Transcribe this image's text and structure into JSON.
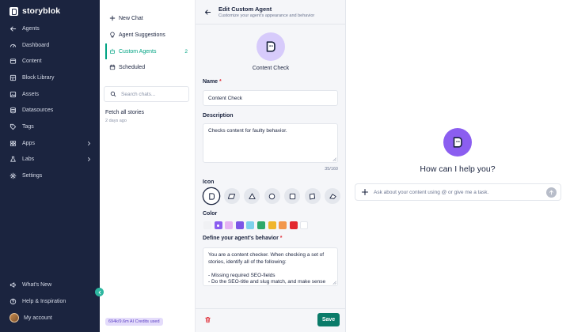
{
  "nav": {
    "brand": "storyblok",
    "items": [
      {
        "label": "Agents",
        "icon": "arrow-left-icon"
      },
      {
        "label": "Dashboard",
        "icon": "dashboard-icon"
      },
      {
        "label": "Content",
        "icon": "content-icon"
      },
      {
        "label": "Block Library",
        "icon": "block-library-icon"
      },
      {
        "label": "Assets",
        "icon": "image-icon"
      },
      {
        "label": "Datasources",
        "icon": "database-icon"
      },
      {
        "label": "Tags",
        "icon": "tag-icon"
      },
      {
        "label": "Apps",
        "icon": "apps-icon"
      },
      {
        "label": "Labs",
        "icon": "labs-icon"
      },
      {
        "label": "Settings",
        "icon": "gear-icon"
      }
    ],
    "bottom": [
      {
        "label": "What's New",
        "icon": "megaphone-icon"
      },
      {
        "label": "Help & Inspiration",
        "icon": "help-icon"
      },
      {
        "label": "My account",
        "icon": "avatar"
      }
    ]
  },
  "chats": {
    "new_chat": "New Chat",
    "agent_suggestions": "Agent Suggestions",
    "custom_agents": "Custom Agents",
    "custom_agents_count": "2",
    "scheduled": "Scheduled",
    "search_placeholder": "Search chats...",
    "recent": [
      {
        "title": "Fetch all stories",
        "time": "2 days ago"
      }
    ],
    "credits": "694k/9.6m AI Credits used"
  },
  "edit": {
    "title": "Edit Custom Agent",
    "subtitle": "Customize your agent's appearance and behavior",
    "agent_name": "Content Check",
    "name_label": "Name",
    "name_value": "Content Check",
    "description_label": "Description",
    "description_value": "Checks content for faulty behavior.",
    "char_count": "35/160",
    "icon_label": "Icon",
    "color_label": "Color",
    "colors": [
      "#f0f1f4",
      "#8b5ef0",
      "#e6b3f2",
      "#7c55e6",
      "#7dd1ec",
      "#2ea86a",
      "#f0b52b",
      "#f2974c",
      "#e3282f",
      "#ffffff"
    ],
    "selected_color_index": 1,
    "behavior_label": "Define your agent's behavior",
    "behavior_value": "You are a content checker. When checking a set of stories, identify all of the following:\n\n- Missing required SEO-fields\n- Do the SEO-title and slug match, and make sense together?",
    "save_label": "Save"
  },
  "preview": {
    "greeting": "How can I help you?",
    "prompt_placeholder": "Ask about your content using @ or give me a task."
  }
}
